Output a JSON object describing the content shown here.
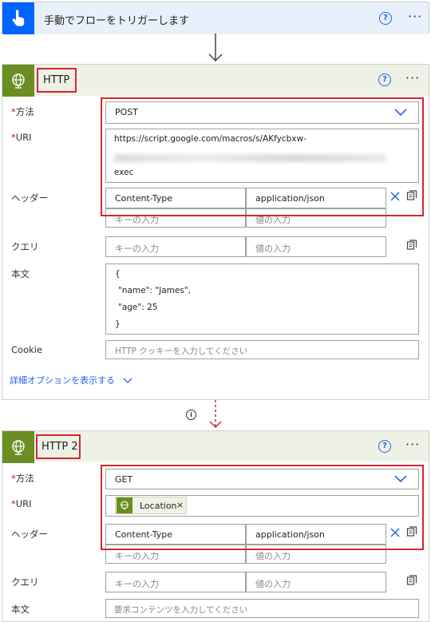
{
  "trigger": {
    "title": "手動でフローをトリガーします",
    "help_icon": "help-circle-icon",
    "more_icon": "more-icon"
  },
  "http1": {
    "title": "HTTP",
    "method_label": "方法",
    "method_value": "POST",
    "uri_label": "URI",
    "uri_line1": "https://script.google.com/macros/s/AKfycbxw-",
    "uri_line3": "exec",
    "headers_label": "ヘッダー",
    "header_key": "Content-Type",
    "header_value": "application/json",
    "key_placeholder": "キーの入力",
    "value_placeholder": "値の入力",
    "query_label": "クエリ",
    "body_label": "本文",
    "body_lines": [
      "{",
      "\"name\": \"James\",",
      "\"age\": 25",
      "}"
    ],
    "cookie_label": "Cookie",
    "cookie_placeholder": "HTTP クッキーを入力してください",
    "advanced_link": "詳細オプションを表示する"
  },
  "http2": {
    "title": "HTTP 2",
    "method_label": "方法",
    "method_value": "GET",
    "uri_label": "URI",
    "uri_token": "Location",
    "headers_label": "ヘッダー",
    "header_key": "Content-Type",
    "header_value": "application/json",
    "key_placeholder": "キーの入力",
    "value_placeholder": "値の入力",
    "query_label": "クエリ",
    "body_label": "本文",
    "body_placeholder": "要求コンテンツを入力してください"
  },
  "required_mark": "*",
  "colors": {
    "accent": "#2266e3",
    "highlight": "#d6262d",
    "http_tile": "#6b8e23",
    "trigger_tile": "#0066ff"
  }
}
